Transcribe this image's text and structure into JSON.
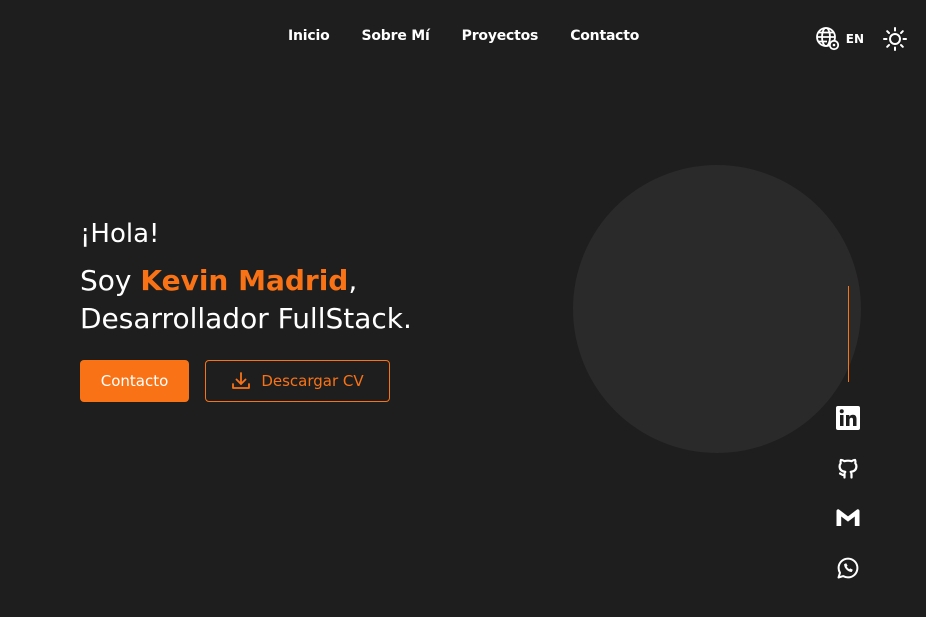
{
  "nav": {
    "links": [
      "Inicio",
      "Sobre Mí",
      "Proyectos",
      "Contacto"
    ],
    "language_label": "EN",
    "language_icon": "globe-gear-icon",
    "theme_icon": "sun-icon"
  },
  "hero": {
    "greeting": "¡Hola!",
    "intro_prefix": "Soy ",
    "name": "Kevin Madrid",
    "intro_suffix": ",",
    "role": "Desarrollador FullStack.",
    "contact_button": "Contacto",
    "cv_button": "Descargar CV",
    "cv_icon": "download-icon"
  },
  "social": [
    "linkedin-icon",
    "github-icon",
    "gmail-icon",
    "whatsapp-icon"
  ],
  "colors": {
    "background": "#1e1e1e",
    "accent": "#f97316",
    "circle": "#2a2a2a",
    "text": "#ffffff"
  }
}
